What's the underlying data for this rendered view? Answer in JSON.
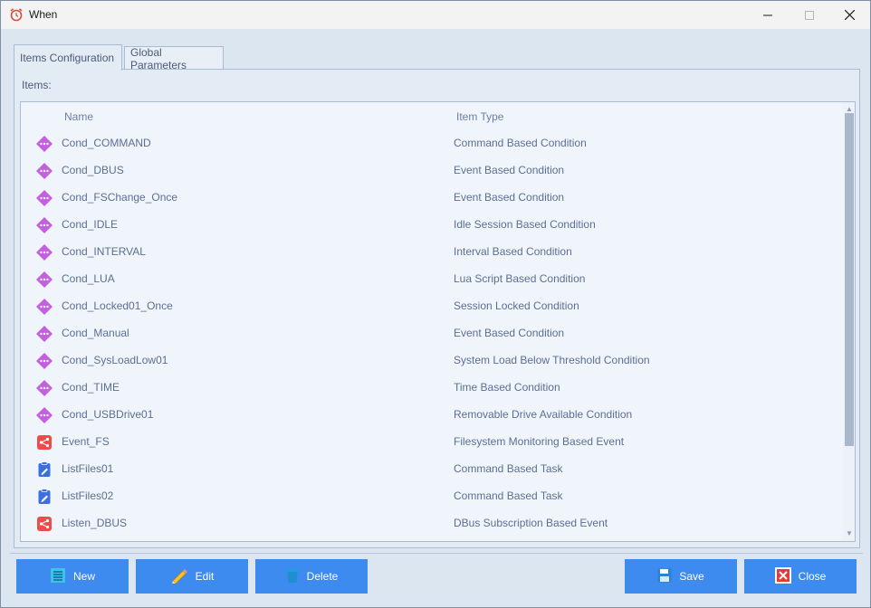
{
  "window": {
    "title": "When"
  },
  "tabs": [
    {
      "label": "Items Configuration",
      "active": true
    },
    {
      "label": "Global Parameters",
      "active": false
    }
  ],
  "items_label": "Items:",
  "columns": {
    "name": "Name",
    "type": "Item Type"
  },
  "rows": [
    {
      "name": "Cond_COMMAND",
      "type": "Command Based Condition",
      "icon": "condition-icon"
    },
    {
      "name": "Cond_DBUS",
      "type": "Event Based Condition",
      "icon": "condition-icon"
    },
    {
      "name": "Cond_FSChange_Once",
      "type": "Event Based Condition",
      "icon": "condition-icon"
    },
    {
      "name": "Cond_IDLE",
      "type": "Idle Session Based Condition",
      "icon": "condition-icon"
    },
    {
      "name": "Cond_INTERVAL",
      "type": "Interval Based Condition",
      "icon": "condition-icon"
    },
    {
      "name": "Cond_LUA",
      "type": "Lua Script Based Condition",
      "icon": "condition-icon"
    },
    {
      "name": "Cond_Locked01_Once",
      "type": "Session Locked Condition",
      "icon": "condition-icon"
    },
    {
      "name": "Cond_Manual",
      "type": "Event Based Condition",
      "icon": "condition-icon"
    },
    {
      "name": "Cond_SysLoadLow01",
      "type": "System Load Below Threshold Condition",
      "icon": "condition-icon"
    },
    {
      "name": "Cond_TIME",
      "type": "Time Based Condition",
      "icon": "condition-icon"
    },
    {
      "name": "Cond_USBDrive01",
      "type": "Removable Drive Available Condition",
      "icon": "condition-icon"
    },
    {
      "name": "Event_FS",
      "type": "Filesystem Monitoring Based Event",
      "icon": "event-icon"
    },
    {
      "name": "ListFiles01",
      "type": "Command Based Task",
      "icon": "task-icon"
    },
    {
      "name": "ListFiles02",
      "type": "Command Based Task",
      "icon": "task-icon"
    },
    {
      "name": "Listen_DBUS",
      "type": "DBus Subscription Based Event",
      "icon": "event-icon"
    }
  ],
  "buttons": {
    "new": "New",
    "edit": "Edit",
    "delete": "Delete",
    "save": "Save",
    "close": "Close"
  },
  "colors": {
    "accent": "#3d8bef",
    "condition": "#c45fe0",
    "event": "#ef4b4b",
    "task": "#3b6fe0"
  }
}
